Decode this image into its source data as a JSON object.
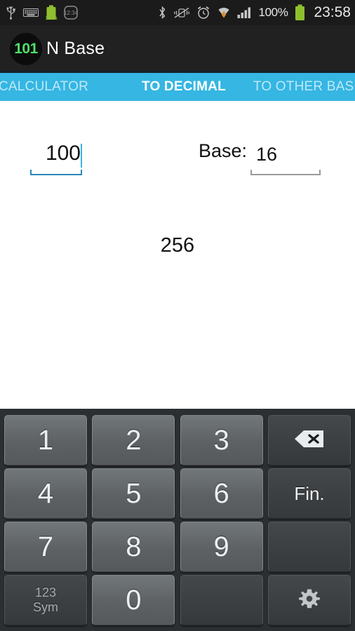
{
  "status_bar": {
    "icons_left": [
      "usb-icon",
      "keyboard-icon",
      "battery-charging-icon",
      "clock-timer-icon"
    ],
    "battery_small_label": "100%",
    "icons_right": [
      "bluetooth-icon",
      "vibrate-mute-icon",
      "alarm-clock-icon",
      "wifi-download-icon",
      "signal-bars-icon"
    ],
    "battery_percent": "100%",
    "battery_icon": "battery-full-icon",
    "time": "23:58",
    "background": "#1b1b1b",
    "accent_green": "#8fbf2f"
  },
  "action_bar": {
    "app_icon_text": "101",
    "app_icon_name": "app-logo-icon",
    "title": "N Base",
    "background": "#212121",
    "icon_text_color": "#4fe06a"
  },
  "tabs": {
    "background": "#35b6e3",
    "active_color": "#ffffff",
    "inactive_color": "#bfe9f8",
    "items": [
      {
        "label": "CALCULATOR",
        "active": false
      },
      {
        "label": "TO DECIMAL",
        "active": true
      },
      {
        "label": "TO OTHER BASE",
        "active": false
      }
    ]
  },
  "converter": {
    "input_value": "100",
    "input_placeholder": "",
    "base_label": "Base:",
    "base_value": "16",
    "base_placeholder": "",
    "result": "256",
    "focus_color": "#2a89b8",
    "unfocused_color": "#9a9a9a"
  },
  "keyboard": {
    "background": "#2c2f32",
    "rows": [
      [
        {
          "label": "1",
          "name": "key-1",
          "type": "num"
        },
        {
          "label": "2",
          "name": "key-2",
          "type": "num"
        },
        {
          "label": "3",
          "name": "key-3",
          "type": "num"
        },
        {
          "label": "",
          "name": "key-backspace",
          "type": "fn",
          "icon": "backspace-icon"
        }
      ],
      [
        {
          "label": "4",
          "name": "key-4",
          "type": "num"
        },
        {
          "label": "5",
          "name": "key-5",
          "type": "num"
        },
        {
          "label": "6",
          "name": "key-6",
          "type": "num"
        },
        {
          "label": "Fin.",
          "name": "key-done",
          "type": "fn"
        }
      ],
      [
        {
          "label": "7",
          "name": "key-7",
          "type": "num"
        },
        {
          "label": "8",
          "name": "key-8",
          "type": "num"
        },
        {
          "label": "9",
          "name": "key-9",
          "type": "num"
        },
        {
          "label": "",
          "name": "key-blank-right",
          "type": "fn"
        }
      ],
      [
        {
          "label": "123\nSym",
          "name": "key-symbols",
          "type": "fn",
          "sym": true
        },
        {
          "label": "0",
          "name": "key-0",
          "type": "num"
        },
        {
          "label": "",
          "name": "key-blank-bottom",
          "type": "fn"
        },
        {
          "label": "",
          "name": "key-settings",
          "type": "fn",
          "icon": "gear-icon"
        }
      ]
    ],
    "symbols_line1": "123",
    "symbols_line2": "Sym"
  }
}
